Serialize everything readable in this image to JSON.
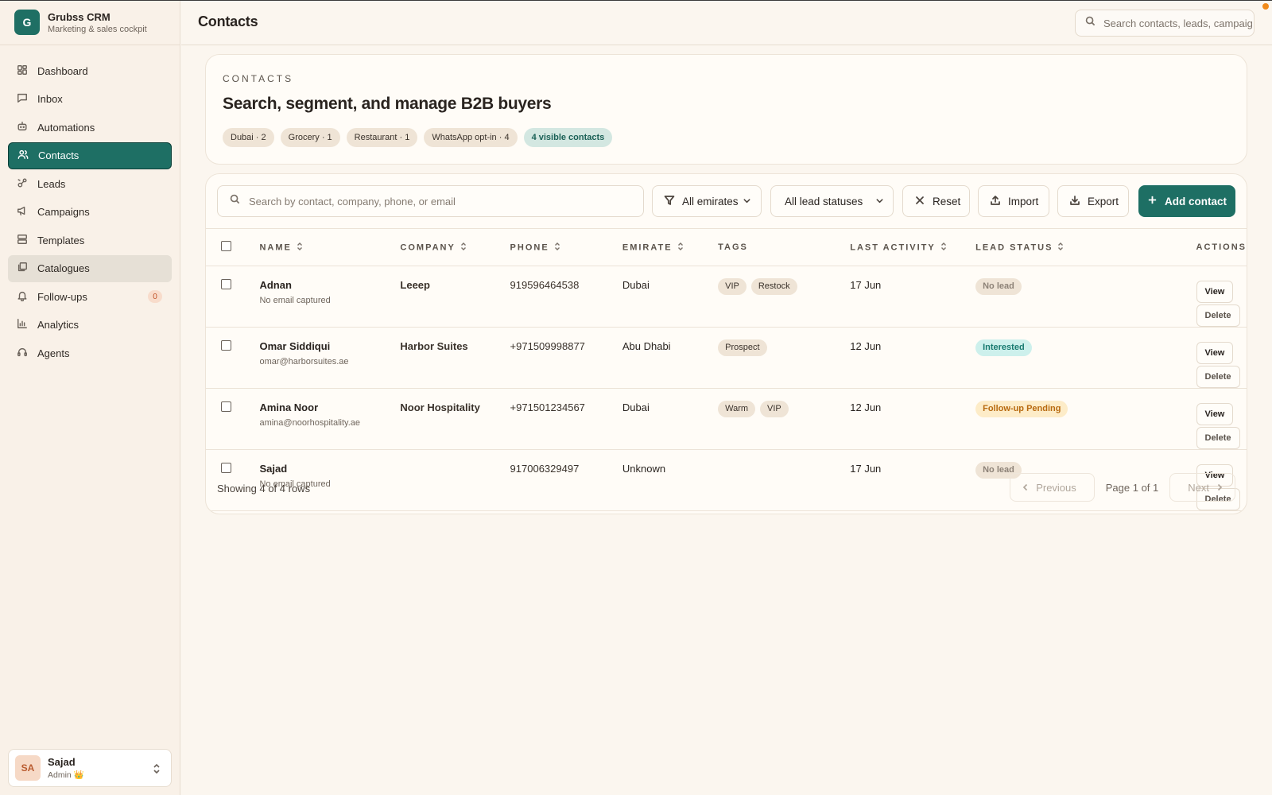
{
  "app": {
    "name": "Grubss CRM",
    "subtitle": "Marketing & sales cockpit",
    "logo_letter": "G",
    "accent_color": "#1e6f64"
  },
  "sidebar": {
    "items": [
      {
        "label": "Dashboard",
        "icon": "dashboard-icon"
      },
      {
        "label": "Inbox",
        "icon": "message-icon"
      },
      {
        "label": "Automations",
        "icon": "bot-icon"
      },
      {
        "label": "Contacts",
        "icon": "users-icon",
        "active": true
      },
      {
        "label": "Leads",
        "icon": "leads-icon"
      },
      {
        "label": "Campaigns",
        "icon": "megaphone-icon"
      },
      {
        "label": "Templates",
        "icon": "templates-icon"
      },
      {
        "label": "Catalogues",
        "icon": "catalogue-icon",
        "hovered": true
      },
      {
        "label": "Follow-ups",
        "icon": "bell-icon",
        "badge": "0"
      },
      {
        "label": "Analytics",
        "icon": "chart-icon"
      },
      {
        "label": "Agents",
        "icon": "headset-icon"
      }
    ],
    "user": {
      "initials": "SA",
      "name": "Sajad",
      "role": "Admin 👑"
    }
  },
  "topbar": {
    "title": "Contacts",
    "search_placeholder": "Search contacts, leads, campaig"
  },
  "hero": {
    "eyebrow": "CONTACTS",
    "title": "Search, segment, and manage B2B buyers",
    "chips": [
      "Dubai · 2",
      "Grocery · 1",
      "Restaurant · 1",
      "WhatsApp opt-in · 4"
    ],
    "visible_chip": "4 visible contacts"
  },
  "toolbar": {
    "search_placeholder": "Search by contact, company, phone, or email",
    "emirate_filter": "All emirates",
    "status_filter": "All lead statuses",
    "reset_label": "Reset",
    "import_label": "Import",
    "export_label": "Export",
    "add_label": "Add contact"
  },
  "table": {
    "headers": [
      "NAME",
      "COMPANY",
      "PHONE",
      "EMIRATE",
      "TAGS",
      "LAST ACTIVITY",
      "LEAD STATUS",
      "ACTIONS"
    ],
    "rows": [
      {
        "name": "Adnan",
        "email": "No email captured",
        "company": "Leeep",
        "phone": "919596464538",
        "emirate": "Dubai",
        "tags": [
          "VIP",
          "Restock"
        ],
        "last_activity": "17 Jun",
        "status": "No lead",
        "status_kind": "nolead"
      },
      {
        "name": "Omar Siddiqui",
        "email": "omar@harborsuites.ae",
        "company": "Harbor Suites",
        "phone": "+971509998877",
        "emirate": "Abu Dhabi",
        "tags": [
          "Prospect"
        ],
        "last_activity": "12 Jun",
        "status": "Interested",
        "status_kind": "interested"
      },
      {
        "name": "Amina Noor",
        "email": "amina@noorhospitality.ae",
        "company": "Noor Hospitality",
        "phone": "+971501234567",
        "emirate": "Dubai",
        "tags": [
          "Warm",
          "VIP"
        ],
        "last_activity": "12 Jun",
        "status": "Follow-up Pending",
        "status_kind": "pending"
      },
      {
        "name": "Sajad",
        "email": "No email captured",
        "company": "",
        "phone": "917006329497",
        "emirate": "Unknown",
        "tags": [],
        "last_activity": "17 Jun",
        "status": "No lead",
        "status_kind": "nolead"
      }
    ],
    "view_label": "View",
    "delete_label": "Delete"
  },
  "footer": {
    "showing": "Showing 4 of 4 rows",
    "previous": "Previous",
    "page_info": "Page 1 of 1",
    "next": "Next"
  }
}
